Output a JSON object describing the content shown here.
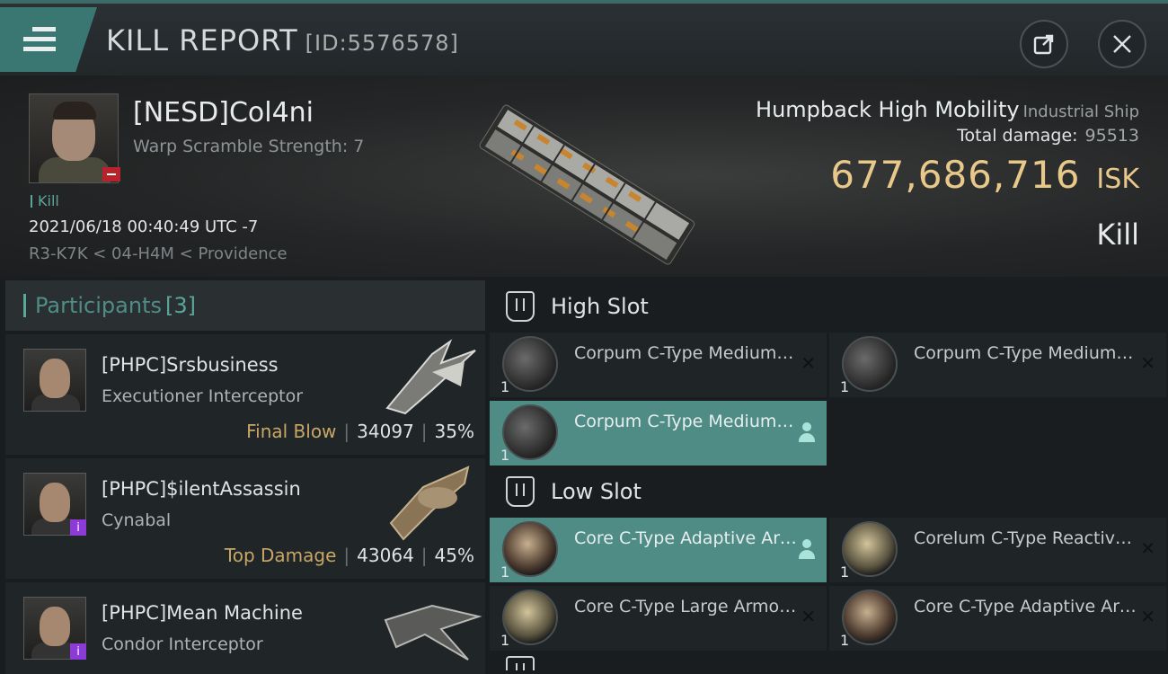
{
  "header": {
    "title": "KILL REPORT",
    "report_id": "[ID:5576578]"
  },
  "victim": {
    "name": "[NESD]Col4ni",
    "warp_scramble": "Warp Scramble Strength: 7",
    "kill_tag": "Kill",
    "datetime": "2021/06/18 00:40:49 UTC -7",
    "location": "R3-K7K < 04-H4M < Providence",
    "ship_name": "Humpback High Mobility",
    "ship_class": "Industrial Ship",
    "total_damage_label": "Total damage:",
    "total_damage_value": "95513",
    "isk_value": "677,686,716",
    "isk_unit": "ISK",
    "outcome": "Kill"
  },
  "participants": {
    "title": "Participants",
    "count": "[3]",
    "rows": [
      {
        "name": "[PHPC]Srsbusiness",
        "ship": "Executioner Interceptor",
        "tag": "Final Blow",
        "damage": "34097",
        "percent": "35%"
      },
      {
        "name": "[PHPC]$ilentAssassin",
        "ship": "Cynabal",
        "tag": "Top Damage",
        "damage": "43064",
        "percent": "45%"
      },
      {
        "name": "[PHPC]Mean Machine",
        "ship": "Condor Interceptor"
      }
    ]
  },
  "slots": {
    "high_label": "High Slot",
    "low_label": "Low Slot",
    "high": [
      {
        "name": "Corpum C-Type Medium Energy Nosferatu",
        "qty": "1"
      },
      {
        "name": "Corpum C-Type Medium Energy Nosferatu",
        "qty": "1"
      },
      {
        "name": "Corpum C-Type Medium Energy Nosferatu",
        "qty": "1"
      }
    ],
    "low": [
      {
        "name": "Core C-Type Adaptive Armor Hardener",
        "qty": "1"
      },
      {
        "name": "Corelum C-Type Reactive Armor Hardener",
        "qty": "1"
      },
      {
        "name": "Core C-Type Large Armor Repairer",
        "qty": "1"
      },
      {
        "name": "Core C-Type Adaptive Armor Hardener",
        "qty": "1"
      }
    ]
  },
  "colors": {
    "accent": "#4f8c86",
    "isk": "#e9c98a",
    "tag": "#c8a766",
    "badge_red": "#b8232b",
    "badge_purple": "#8c3bd6"
  }
}
